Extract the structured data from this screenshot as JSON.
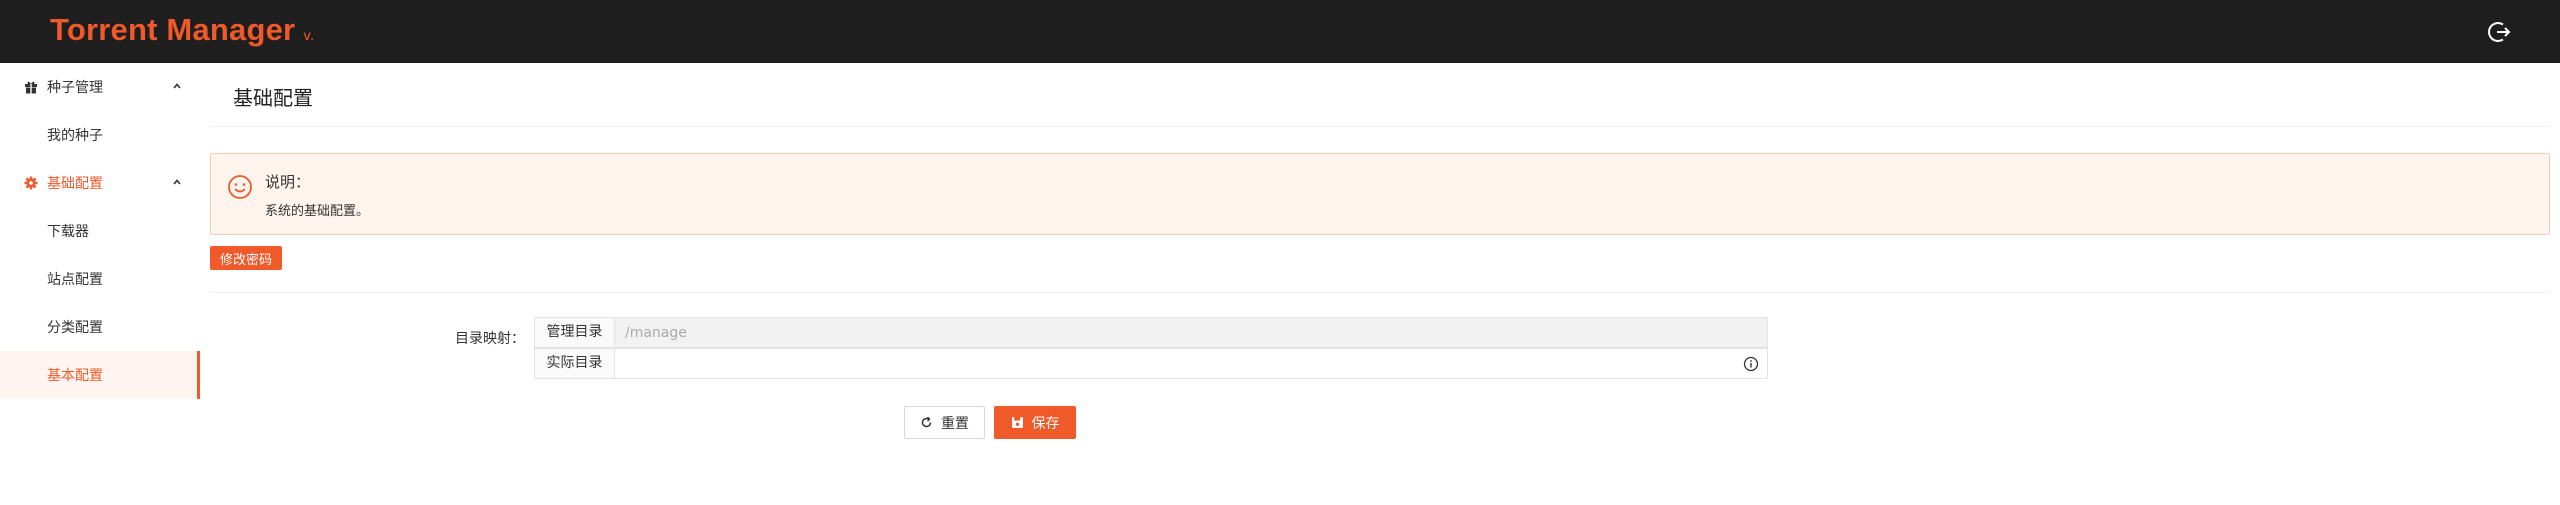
{
  "header": {
    "brand": "Torrent Manager",
    "version": "v."
  },
  "sidebar": {
    "groups": [
      {
        "label": "种子管理",
        "icon": "gift-icon",
        "items": [
          "我的种子"
        ]
      },
      {
        "label": "基础配置",
        "icon": "gear-icon",
        "items": [
          "下载器",
          "站点配置",
          "分类配置",
          "基本配置"
        ]
      }
    ],
    "selected": "基本配置"
  },
  "main": {
    "title": "基础配置",
    "notice": {
      "title": "说明：",
      "desc": "系统的基础配置。"
    },
    "change_password_label": "修改密码",
    "form": {
      "label": "目录映射：",
      "rows": [
        {
          "addon": "管理目录",
          "value": "",
          "placeholder": "/manage",
          "disabled": true
        },
        {
          "addon": "实际目录",
          "value": "",
          "placeholder": ""
        }
      ]
    },
    "buttons": {
      "reset": "重置",
      "save": "保存"
    }
  },
  "colors": {
    "accent": "#f0592a",
    "topbar": "#1e1e1e",
    "notice_bg": "#fff4ee"
  }
}
